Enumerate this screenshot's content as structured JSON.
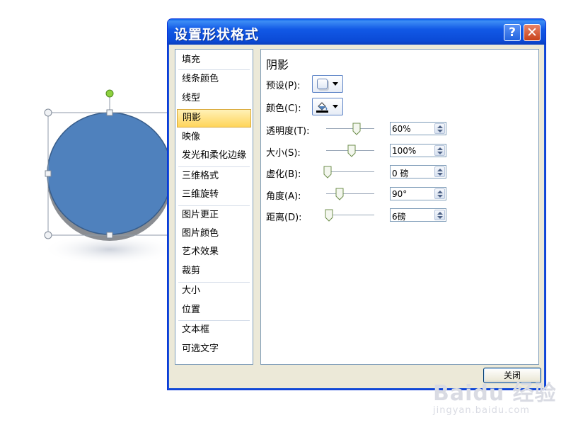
{
  "dialog": {
    "title": "设置形状格式",
    "help_glyph": "?",
    "close_glyph": "✕",
    "close_button_label": "关闭"
  },
  "categories": [
    {
      "label": "填充",
      "selected": false
    },
    {
      "label": "线条颜色",
      "selected": false
    },
    {
      "label": "线型",
      "selected": false
    },
    {
      "label": "阴影",
      "selected": true
    },
    {
      "label": "映像",
      "selected": false
    },
    {
      "label": "发光和柔化边缘",
      "selected": false
    },
    {
      "label": "三维格式",
      "selected": false
    },
    {
      "label": "三维旋转",
      "selected": false
    },
    {
      "label": "图片更正",
      "selected": false
    },
    {
      "label": "图片颜色",
      "selected": false
    },
    {
      "label": "艺术效果",
      "selected": false
    },
    {
      "label": "裁剪",
      "selected": false
    },
    {
      "label": "大小",
      "selected": false
    },
    {
      "label": "位置",
      "selected": false
    },
    {
      "label": "文本框",
      "selected": false
    },
    {
      "label": "可选文字",
      "selected": false
    }
  ],
  "shadow": {
    "section_title": "阴影",
    "preset_label": "预设(P):",
    "color_label": "颜色(C):",
    "color_swatch": "#000000",
    "properties": [
      {
        "key": "transparency",
        "label": "透明度(T):",
        "value": "60%",
        "slider_fraction": 0.6
      },
      {
        "key": "size",
        "label": "大小(S):",
        "value": "100%",
        "slider_fraction": 0.5
      },
      {
        "key": "blur",
        "label": "虚化(B):",
        "value": "0 磅",
        "slider_fraction": 0.0
      },
      {
        "key": "angle",
        "label": "角度(A):",
        "value": "90°",
        "slider_fraction": 0.25
      },
      {
        "key": "distance",
        "label": "距离(D):",
        "value": "6磅",
        "slider_fraction": 0.03
      }
    ]
  },
  "shape": {
    "fill_color": "#4f81bd",
    "outline_color": "#385d8a",
    "shadow_color": "#8a8d92",
    "rotation_handle_color": "#8ed13f"
  },
  "colors": {
    "title_bar": "#0b4ad6",
    "selection_highlight": "#ffd55a"
  },
  "watermark": {
    "main": "Baidu 经验",
    "sub": "jingyan.baidu.com"
  }
}
